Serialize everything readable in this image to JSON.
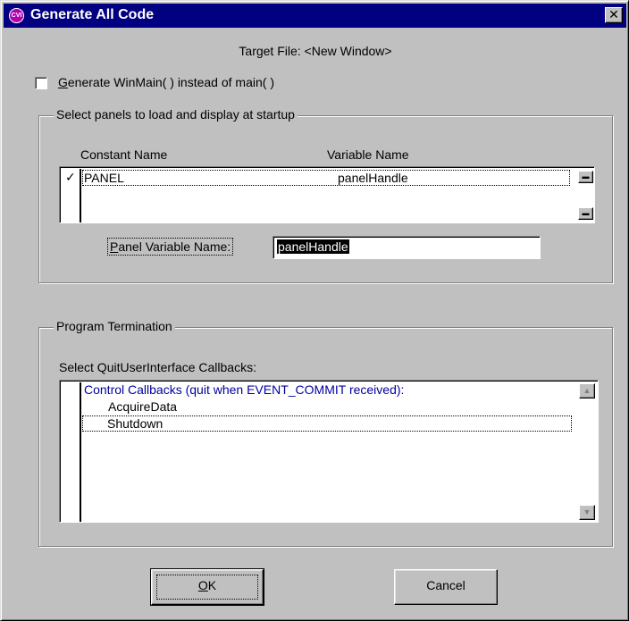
{
  "window": {
    "title": "Generate All Code",
    "icon_text": "CVI",
    "close_glyph": "✕"
  },
  "target_file": "Target File: <New Window>",
  "winmain_option": {
    "label_mnemonic": "G",
    "label_rest": "enerate WinMain( ) instead of main( )",
    "checked": false
  },
  "panels_group": {
    "title": "Select panels to load and display at startup",
    "columns": [
      "Constant Name",
      "Variable Name"
    ],
    "rows": [
      {
        "check": "✓",
        "constant": "PANEL",
        "variable": "panelHandle"
      }
    ],
    "scroll_up_glyph": "▬",
    "scroll_down_glyph": "▬",
    "panel_variable_label_mnemonic": "P",
    "panel_variable_label_rest": "anel Variable Name:",
    "panel_variable_value": "panelHandle"
  },
  "termination_group": {
    "title": "Program Termination",
    "list_label": "Select QuitUserInterface Callbacks:",
    "header_item": "Control Callbacks (quit when EVENT_COMMIT received):",
    "items": [
      "AcquireData",
      "Shutdown"
    ],
    "scroll_up_glyph": "▲",
    "scroll_down_glyph": "▼"
  },
  "buttons": {
    "ok_mnemonic": "O",
    "ok_rest": "K",
    "cancel": "Cancel"
  },
  "colors": {
    "titlebar": "#000080",
    "face": "#c0c0c0",
    "callback_header": "#0000a0"
  }
}
